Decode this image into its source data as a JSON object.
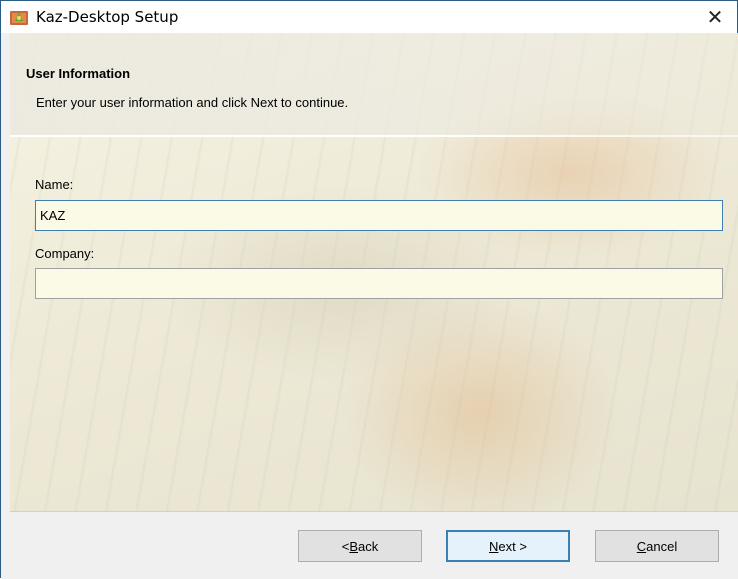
{
  "window": {
    "title": "Kaz-Desktop Setup",
    "close_symbol": "✕"
  },
  "header": {
    "title": "User Information",
    "description": "Enter your user information and click Next to continue."
  },
  "fields": {
    "name": {
      "label": "Name:",
      "value": "KAZ"
    },
    "company": {
      "label": "Company:",
      "value": ""
    }
  },
  "buttons": {
    "back": {
      "pre": "< ",
      "accel": "B",
      "post": "ack"
    },
    "next": {
      "pre": "",
      "accel": "N",
      "post": "ext >"
    },
    "cancel": {
      "pre": "",
      "accel": "C",
      "post": "ancel"
    }
  },
  "colors": {
    "accent": "#3c7fb1",
    "input_bg": "#fafae6",
    "title_border": "#2a5a86"
  },
  "icons": {
    "app": "installer-app-icon",
    "close": "close-icon"
  }
}
